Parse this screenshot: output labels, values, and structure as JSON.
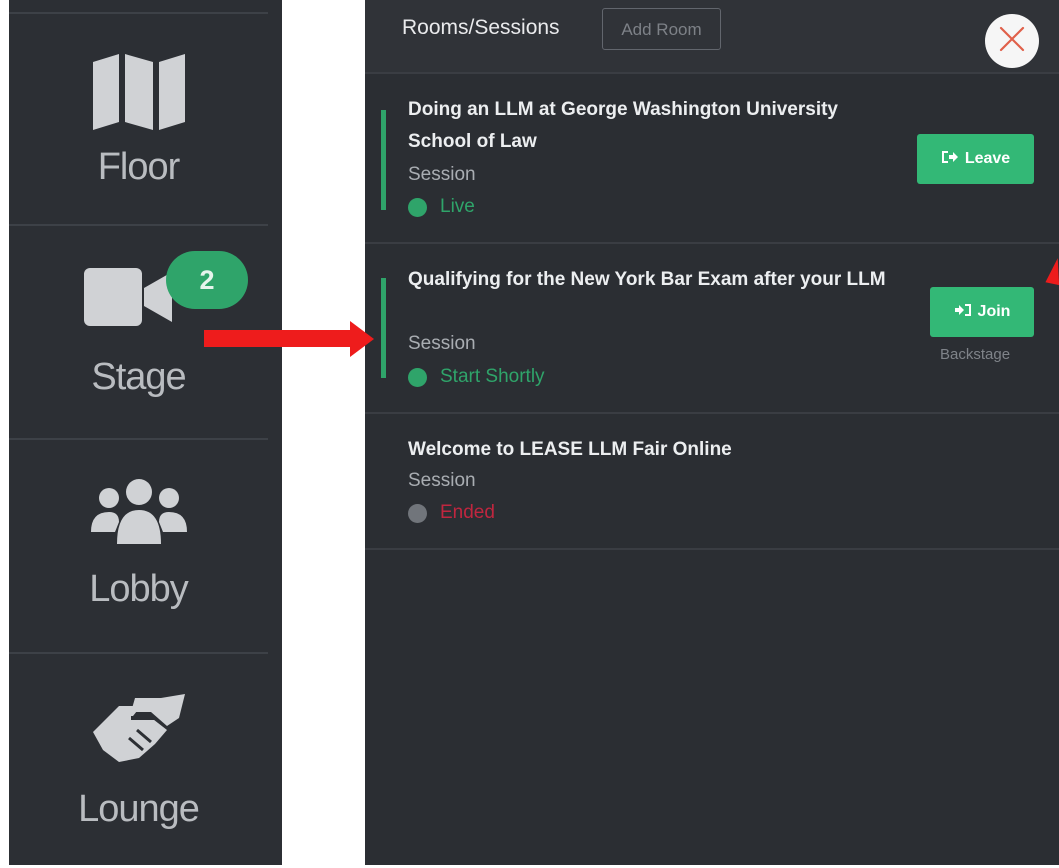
{
  "nav": {
    "items": [
      {
        "label": "Floor",
        "icon": "map-icon"
      },
      {
        "label": "Stage",
        "icon": "video-camera-icon",
        "badge": "2"
      },
      {
        "label": "Lobby",
        "icon": "users-group-icon"
      },
      {
        "label": "Lounge",
        "icon": "handshake-icon"
      }
    ]
  },
  "panel": {
    "title": "Rooms/Sessions",
    "add_room_label": "Add Room",
    "close_icon": "close-icon"
  },
  "sessions": [
    {
      "title": "Doing an LLM at George Washington University School of Law",
      "type": "Session",
      "status": "Live",
      "status_color": "#2fa46a",
      "dot_color": "#2fa46a",
      "action_label": "Leave",
      "action_icon": "sign-out-icon"
    },
    {
      "title": "Qualifying for the New York Bar Exam after your LLM",
      "type": "Session",
      "status": "Start Shortly",
      "status_color": "#2fa46a",
      "dot_color": "#2fa46a",
      "action_label": "Join",
      "action_icon": "sign-in-icon",
      "action_note": "Backstage"
    },
    {
      "title": "Welcome to LEASE LLM Fair Online",
      "type": "Session",
      "status": "Ended",
      "status_color": "#c0263f",
      "dot_color": "#71757b"
    }
  ],
  "colors": {
    "accent_green": "#2fa46a",
    "button_green": "#33b876",
    "annotation_red": "#ee1c1c"
  }
}
